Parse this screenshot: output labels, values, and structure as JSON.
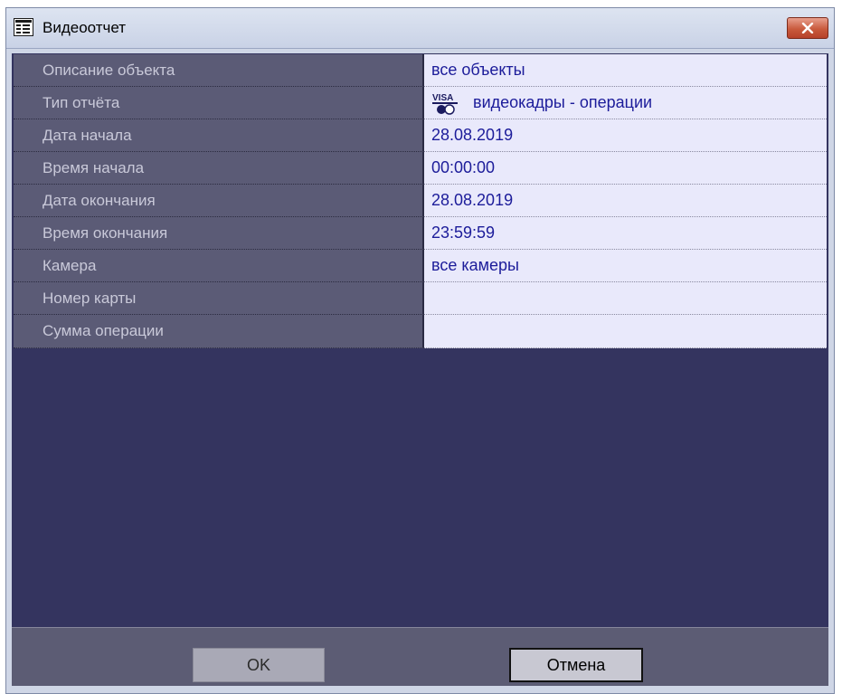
{
  "window": {
    "title": "Видеоотчет",
    "close_label": "x"
  },
  "properties": [
    {
      "label": "Описание объекта",
      "value": "все объекты"
    },
    {
      "label": "Тип отчёта",
      "value": "видеокадры - операции",
      "icon": "visa-card-icon",
      "icon_text": "VISA"
    },
    {
      "label": "Дата начала",
      "value": "28.08.2019"
    },
    {
      "label": "Время начала",
      "value": "00:00:00"
    },
    {
      "label": "Дата окончания",
      "value": "28.08.2019"
    },
    {
      "label": "Время окончания",
      "value": "23:59:59"
    },
    {
      "label": "Камера",
      "value": "все камеры"
    },
    {
      "label": "Номер карты",
      "value": ""
    },
    {
      "label": "Сумма операции",
      "value": ""
    }
  ],
  "buttons": {
    "ok": "OK",
    "cancel": "Отмена"
  },
  "colors": {
    "background": "#34345f",
    "label_cell": "#5b5b76",
    "value_cell": "#e9e9fb",
    "value_text": "#1c1c9a",
    "close_button": "#c95a3d"
  }
}
